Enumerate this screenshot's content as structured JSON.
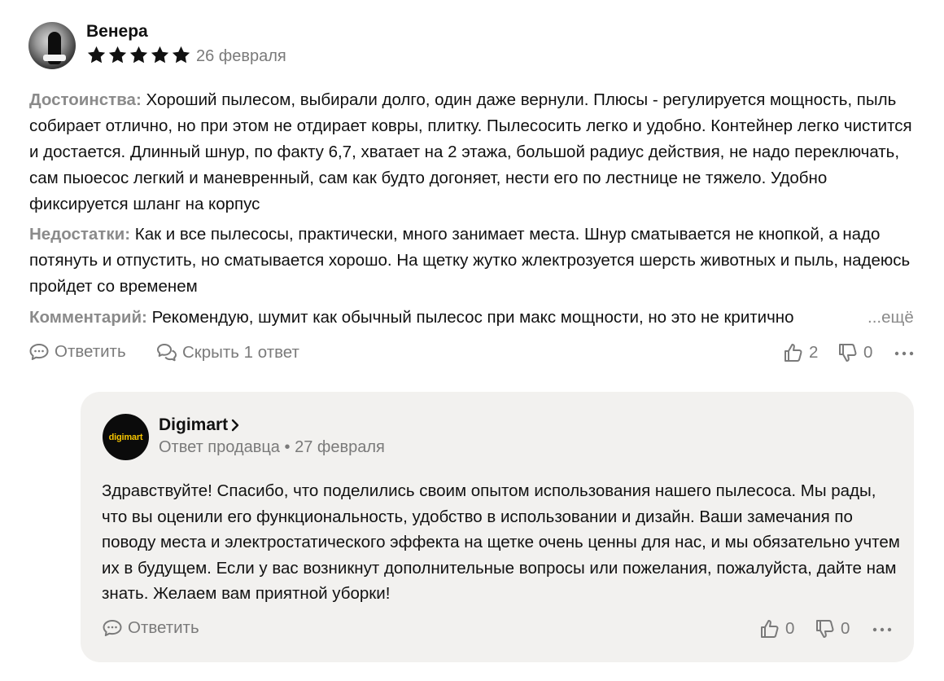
{
  "review": {
    "author": "Венера",
    "rating": 5,
    "date": "26 февраля",
    "pros_label": "Достоинства:",
    "pros_text": "Хороший пылесом, выбирали долго, один даже вернули. Плюсы - регулируется мощность, пыль собирает отлично, но при этом не отдирает ковры, плитку. Пылесосить легко и удобно. Контейнер легко чистится и достается. Длинный шнур, по факту 6,7, хватает на 2 этажа, большой радиус действия, не надо переключать, сам пыоесос легкий и маневренный, сам как будто догоняет, нести его по лестнице не тяжело. Удобно фиксируется шланг на корпус",
    "cons_label": "Недостатки:",
    "cons_text": "Как и все пылесосы, практически, много занимает места. Шнур сматывается не кнопкой, а надо потянуть и отпустить, но сматывается хорошо. На щетку жутко жлектрозуется шерсть животных и пыль, надеюсь пройдет со временем",
    "comment_label": "Комментарий:",
    "comment_text": "Рекомендую, шумит как обычный пылесос при макс мощности, но это не критично",
    "more_label": "...ещё",
    "actions": {
      "reply": "Ответить",
      "hide_replies": "Скрыть 1 ответ",
      "likes": "2",
      "dislikes": "0"
    }
  },
  "seller_reply": {
    "logo_text": "digimart",
    "name": "Digimart",
    "role": "Ответ продавца",
    "separator": "•",
    "date": "27 февраля",
    "text": "Здравствуйте! Спасибо, что поделились своим опытом использования нашего пылесоса. Мы рады, что вы оценили его функциональность, удобство в использовании и дизайн. Ваши замечания по поводу места и электростатического эффекта на щетке очень ценны для нас, и мы обязательно учтем их в будущем. Если у вас возникнут дополнительные вопросы или пожелания, пожалуйста, дайте нам знать. Желаем вам приятной уборки!",
    "actions": {
      "reply": "Ответить",
      "likes": "0",
      "dislikes": "0"
    }
  },
  "icons": [
    "chat-bubble-icon",
    "chat-bubbles-icon",
    "thumb-up-icon",
    "thumb-down-icon",
    "more-dots-icon",
    "star-icon",
    "chevron-right-icon"
  ],
  "colors": {
    "star": "#111111",
    "muted_text": "#7a7a7a",
    "label_text": "#8a8a8a",
    "card_bg": "#f2f1ef",
    "logo_bg": "#0b0b0b",
    "logo_text": "#f5c400"
  }
}
